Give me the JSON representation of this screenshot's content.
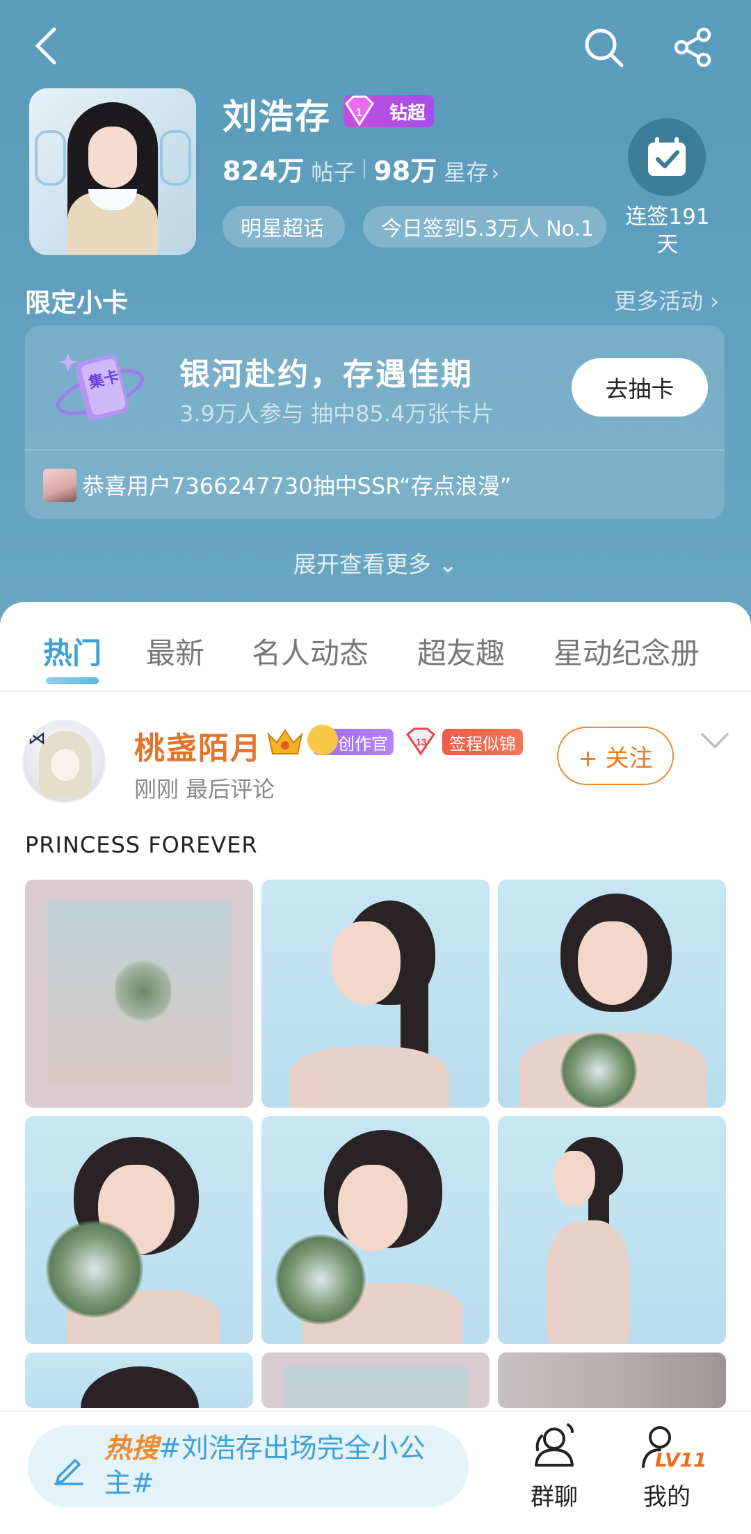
{
  "header": {
    "back_icon": "back-arrow-icon",
    "search_icon": "search-icon",
    "share_icon": "share-icon"
  },
  "profile": {
    "name": "刘浩存",
    "badge": "钻超",
    "posts_count": "824万",
    "posts_label": "帖子",
    "stars_count": "98万",
    "stars_label": "星存",
    "stars_chevron": "›",
    "tag_star": "明星超话",
    "checkin_rank": "今日签到5.3万人 No.1",
    "streak_text": "连签191天"
  },
  "limited_cards": {
    "title": "限定小卡",
    "more": "更多活动 ›",
    "card_icon_text": "集卡",
    "card_title": "银河赴约，存遇佳期",
    "card_sub": "3.9万人参与 抽中85.4万张卡片",
    "draw_button": "去抽卡",
    "winner_text": "恭喜用户7366247730抽中SSR“存点浪漫”",
    "expand": "展开查看更多 ⌄"
  },
  "tabs": [
    {
      "label": "热门",
      "active": true
    },
    {
      "label": "最新",
      "active": false
    },
    {
      "label": "名人动态",
      "active": false
    },
    {
      "label": "超友趣",
      "active": false
    },
    {
      "label": "星动纪念册",
      "active": false
    }
  ],
  "post": {
    "author": "桃盏陌月",
    "creator_badge": "创作官",
    "gem_level": "13",
    "sign_badge": "签程似锦",
    "meta": "刚刚 最后评论",
    "follow_button": "+ 关注",
    "text": "PRINCESS FOREVER"
  },
  "bottom": {
    "hot_label": "热搜",
    "compose_text": "#刘浩存出场完全小公主#",
    "nav_group": "群聊",
    "nav_me": "我的",
    "level": "LV11"
  },
  "colors": {
    "header_bg": "#5f9fbd",
    "accent_blue": "#3d9fd3",
    "author_orange": "#e2742b",
    "follow_orange": "#ef7a1c",
    "diamond_purple": "#b84ee3"
  }
}
